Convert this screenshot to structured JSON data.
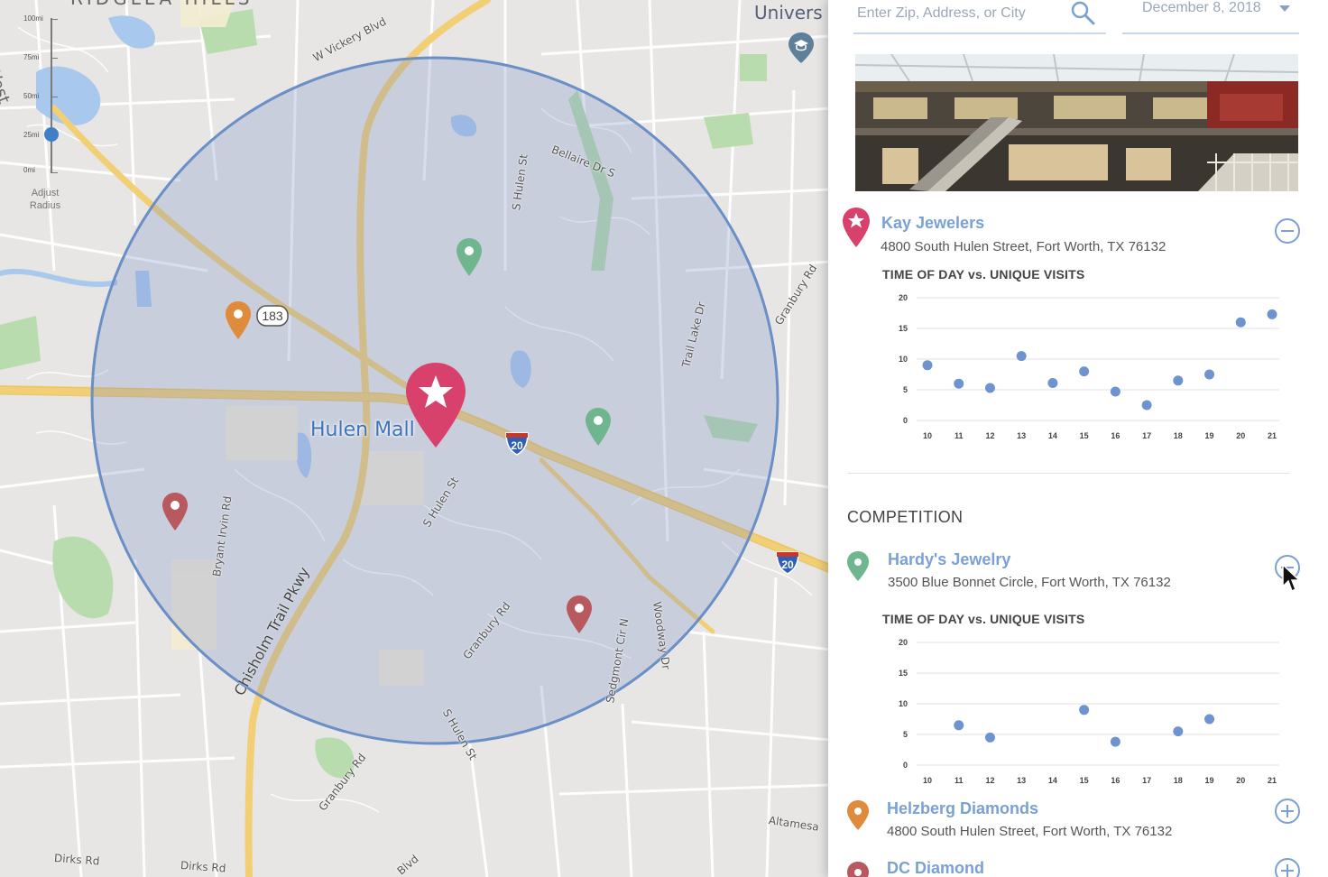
{
  "map": {
    "labels": {
      "univers": "Univers",
      "w_vickery": "W Vickery Blvd",
      "bellaire": "Bellaire Dr S",
      "s_hulen_top": "S Hulen St",
      "trail_lake": "Trail Lake Dr",
      "granbury_right": "Granbury Rd",
      "hulen_mall": "Hulen Mall",
      "s_hulen_mid": "S Hulen St",
      "bryant_irvin": "Bryant Irvin Rd",
      "chisholm": "Chisholm Trail Pkwy",
      "granbury_mid": "Granbury Rd",
      "sedgmont": "Sedgmont Cir N",
      "woodway": "Woodway Dr",
      "s_hulen_bottom": "S Hulen St",
      "granbury_bottom": "Granbury Rd",
      "altamesa": "Altamesa",
      "dirks_left": "Dirks Rd",
      "dirks_right": "Dirks Rd",
      "blvd_bottom": "Blvd",
      "west_edge": "West",
      "ridglea": "RIDGLEA HILLS"
    },
    "shields": {
      "us183": "183",
      "i20_a": "20",
      "i20_b": "20"
    },
    "radius": {
      "ticks": [
        "100mi",
        "75mi",
        "50mi",
        "25mi",
        "0mi"
      ],
      "selected_fraction": 0.25,
      "label_line1": "Adjust",
      "label_line2": "Radius"
    },
    "colors": {
      "circle": "#6a8fc6",
      "road": "#f2cf74",
      "water": "#a9c8ee",
      "park": "#b8dcae",
      "main_pin": "#d9416d",
      "green_pin": "#6fb68e",
      "orange_pin": "#e08a3c",
      "red_pin": "#b8585f"
    }
  },
  "panel": {
    "search": {
      "placeholder": "Enter Zip, Address, or City",
      "value": ""
    },
    "date": {
      "value": "December 8, 2018"
    },
    "primary": {
      "name": "Kay Jewelers",
      "address": "4800 South Hulen Street, Fort Worth, TX 76132",
      "chart_title": "TIME OF DAY vs. UNIQUE VISITS"
    },
    "competition_heading": "COMPETITION",
    "competitors": [
      {
        "name": "Hardy's Jewelry",
        "address": "3500 Blue Bonnet Circle, Fort Worth, TX 76132",
        "chart_title": "TIME OF DAY vs. UNIQUE VISITS",
        "expanded": true
      },
      {
        "name": "Helzberg Diamonds",
        "address": "4800 South Hulen Street, Fort Worth, TX 76132",
        "expanded": false
      },
      {
        "name": "DC Diamond",
        "address": "",
        "expanded": false
      }
    ],
    "colors": {
      "accent": "#7aa0d6",
      "dot": "#6f93cf",
      "primary_pin": "#d9416d",
      "green_pin": "#6fb68e",
      "orange_pin": "#e08a3c",
      "red_pin": "#b8585f"
    }
  },
  "chart_data": [
    {
      "type": "scatter",
      "title": "TIME OF DAY vs. UNIQUE VISITS",
      "x_ticks": [
        "10",
        "11",
        "12",
        "13",
        "14",
        "15",
        "16",
        "17",
        "18",
        "19",
        "20",
        "21"
      ],
      "y_ticks": [
        "0",
        "5",
        "10",
        "15",
        "20"
      ],
      "ylim": [
        0,
        20
      ],
      "grid": true,
      "points": [
        [
          10,
          9
        ],
        [
          11,
          6
        ],
        [
          12,
          5.3
        ],
        [
          13,
          10.5
        ],
        [
          14,
          6.1
        ],
        [
          15,
          8
        ],
        [
          16,
          4.7
        ],
        [
          17,
          2.5
        ],
        [
          18,
          6.5
        ],
        [
          19,
          7.5
        ],
        [
          20,
          16
        ],
        [
          21,
          17.3
        ]
      ]
    },
    {
      "type": "scatter",
      "title": "TIME OF DAY vs. UNIQUE VISITS",
      "x_ticks": [
        "10",
        "11",
        "12",
        "13",
        "14",
        "15",
        "16",
        "17",
        "18",
        "19",
        "20",
        "21"
      ],
      "y_ticks": [
        "0",
        "5",
        "10",
        "15",
        "20"
      ],
      "ylim": [
        0,
        20
      ],
      "grid": true,
      "points": [
        [
          11,
          6.5
        ],
        [
          12,
          4.5
        ],
        [
          15,
          9
        ],
        [
          16,
          3.8
        ],
        [
          18,
          5.5
        ],
        [
          19,
          7.5
        ]
      ]
    }
  ]
}
